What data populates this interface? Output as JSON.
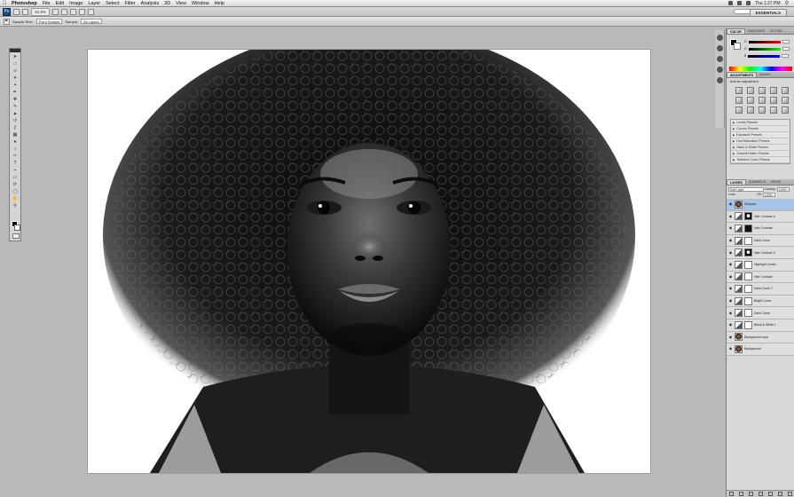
{
  "menubar": {
    "items": [
      "Photoshop",
      "File",
      "Edit",
      "Image",
      "Layer",
      "Select",
      "Filter",
      "Analysis",
      "3D",
      "View",
      "Window",
      "Help"
    ],
    "clock": "Thu 1:27 PM"
  },
  "appbar": {
    "zoom": "33.3%",
    "workspace": "ESSENTIALS"
  },
  "options": {
    "sample_size_label": "Sample Size:",
    "sample_size_value": "Point Sample",
    "sample_label": "Sample:",
    "sample_value": "All Layers"
  },
  "panels": {
    "color_tabs": [
      "COLOR",
      "SWATCHES",
      "STYLES"
    ],
    "color_channels": [
      "R",
      "G",
      "B"
    ],
    "adj_tabs": [
      "ADJUSTMENTS",
      "MASKS"
    ],
    "adj_heading": "Add an adjustment",
    "presets": [
      "Levels Presets",
      "Curves Presets",
      "Exposure Presets",
      "Hue/Saturation Presets",
      "Black & White Presets",
      "Channel Mixer Presets",
      "Selective Color Presets"
    ],
    "layers_tabs": [
      "LAYERS",
      "CHANNELS",
      "PATHS"
    ],
    "blend_mode": "Soft Light",
    "opacity_label": "Opacity:",
    "opacity_value": "100%",
    "fill_label": "Fill:",
    "fill_value": "100%",
    "lock_label": "Lock:"
  },
  "layers": [
    {
      "name": "Sharpen",
      "thumb": "photo",
      "mask": "",
      "selected": true
    },
    {
      "name": "Hair Contrast 4",
      "thumb": "adj",
      "mask": "face"
    },
    {
      "name": "Hair Contrast",
      "thumb": "adj",
      "mask": "dark"
    },
    {
      "name": "Dark Curve",
      "thumb": "adj",
      "mask": "white"
    },
    {
      "name": "Hair Contrast 3",
      "thumb": "adj",
      "mask": "face"
    },
    {
      "name": "Highlight Levels",
      "thumb": "adj",
      "mask": "white"
    },
    {
      "name": "Hair Contrast",
      "thumb": "adj",
      "mask": "white"
    },
    {
      "name": "Dark Curve 2",
      "thumb": "adj",
      "mask": "white"
    },
    {
      "name": "Bright Curve",
      "thumb": "adj",
      "mask": "white"
    },
    {
      "name": "Dark Curve",
      "thumb": "adj",
      "mask": "white"
    },
    {
      "name": "Black & White 1",
      "thumb": "adj",
      "mask": "white"
    },
    {
      "name": "Background copy",
      "thumb": "photo",
      "mask": ""
    },
    {
      "name": "Background",
      "thumb": "photo",
      "mask": ""
    }
  ]
}
